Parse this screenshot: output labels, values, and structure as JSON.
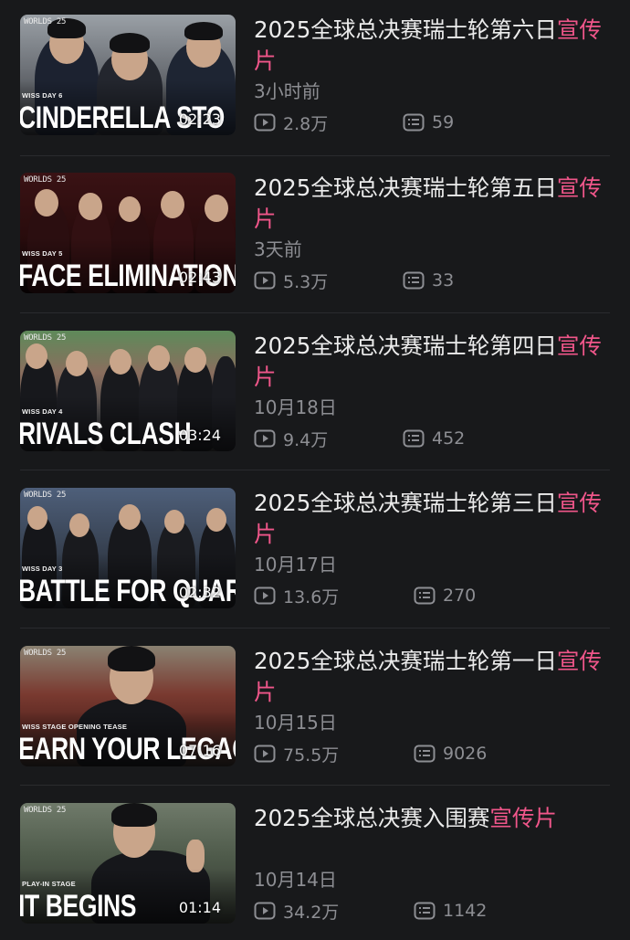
{
  "videos": [
    {
      "title_main": "2025全球总决赛瑞士轮第六日",
      "title_accent": "宣传片",
      "date": "3小时前",
      "views": "2.8万",
      "comments": "59",
      "duration": "02:23",
      "thumb_logo": "WORLDS 25",
      "thumb_tag": "WISS DAY 6",
      "thumb_headline": "CINDERELLA STO"
    },
    {
      "title_main": "2025全球总决赛瑞士轮第五日",
      "title_accent": "宣传片",
      "date": "3天前",
      "views": "5.3万",
      "comments": "33",
      "duration": "02:43",
      "thumb_logo": "WORLDS 25",
      "thumb_tag": "WISS DAY 5",
      "thumb_headline": "FACE ELIMINATION"
    },
    {
      "title_main": "2025全球总决赛瑞士轮第四日",
      "title_accent": "宣传片",
      "date": "10月18日",
      "views": "9.4万",
      "comments": "452",
      "duration": "03:24",
      "thumb_logo": "WORLDS 25",
      "thumb_tag": "WISS DAY 4",
      "thumb_headline": "RIVALS CLASH"
    },
    {
      "title_main": "2025全球总决赛瑞士轮第三日",
      "title_accent": "宣传片",
      "date": "10月17日",
      "views": "13.6万",
      "comments": "270",
      "duration": "02:32",
      "thumb_logo": "WORLDS 25",
      "thumb_tag": "WISS DAY 3",
      "thumb_headline": "BATTLE FOR QUARTERS"
    },
    {
      "title_main": "2025全球总决赛瑞士轮第一日",
      "title_accent": "宣传片",
      "date": "10月15日",
      "views": "75.5万",
      "comments": "9026",
      "duration": "07:16",
      "thumb_logo": "WORLDS 25",
      "thumb_tag": "WISS STAGE OPENING TEASE",
      "thumb_headline": "EARN YOUR LEGACY"
    },
    {
      "title_main": "2025全球总决赛入围赛",
      "title_accent": "宣传片",
      "date": "10月14日",
      "views": "34.2万",
      "comments": "1142",
      "duration": "01:14",
      "thumb_logo": "WORLDS 25",
      "thumb_tag": "PLAY-IN STAGE",
      "thumb_headline": "IT BEGINS"
    }
  ],
  "colors": {
    "background": "#18191b",
    "title": "#ececec",
    "accent": "#f0568a",
    "meta": "#8d8e93"
  },
  "icons": {
    "views": "play-count-icon",
    "comments": "comment-count-icon"
  }
}
